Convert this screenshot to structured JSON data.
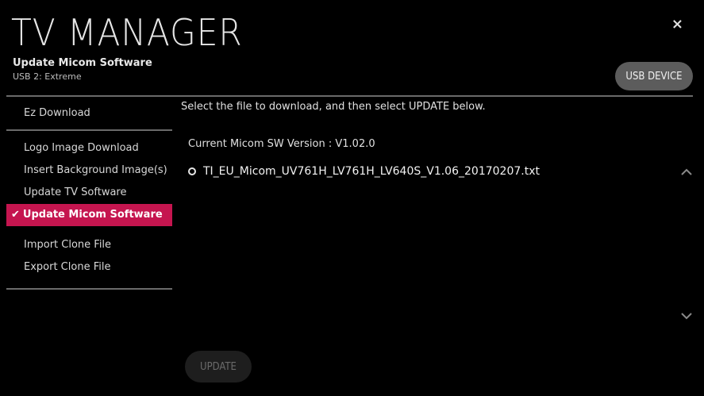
{
  "header": {
    "title": "TV MANAGER",
    "subtitle": "Update Micom Software",
    "device": "USB 2: Extreme",
    "close_label": "×",
    "usb_button": "USB DEVICE"
  },
  "sidebar": {
    "items": [
      {
        "label": "Ez Download"
      },
      {
        "label": "Logo Image Download"
      },
      {
        "label": "Insert Background Image(s)"
      },
      {
        "label": "Update TV Software"
      },
      {
        "label": "Update Micom Software",
        "selected": true
      },
      {
        "label": "Import Clone File"
      },
      {
        "label": "Export Clone File"
      }
    ],
    "selected_check": "✔"
  },
  "main": {
    "instruction": "Select the file to download, and then select UPDATE below.",
    "version_text": "Current Micom SW Version :  V1.02.0",
    "files": [
      {
        "name": "TI_EU_Micom_UV761H_LV761H_LV640S_V1.06_20170207.txt"
      }
    ],
    "update_button": "UPDATE",
    "update_enabled": false
  },
  "colors": {
    "accent": "#c5154f",
    "background": "#000000",
    "divider": "#6a6a6a",
    "button_gray": "#5c5c5c"
  },
  "icons": {
    "scroll_up": "chevron-up-icon",
    "scroll_down": "chevron-down-icon",
    "close": "close-icon",
    "file_marker": "radio-icon"
  }
}
